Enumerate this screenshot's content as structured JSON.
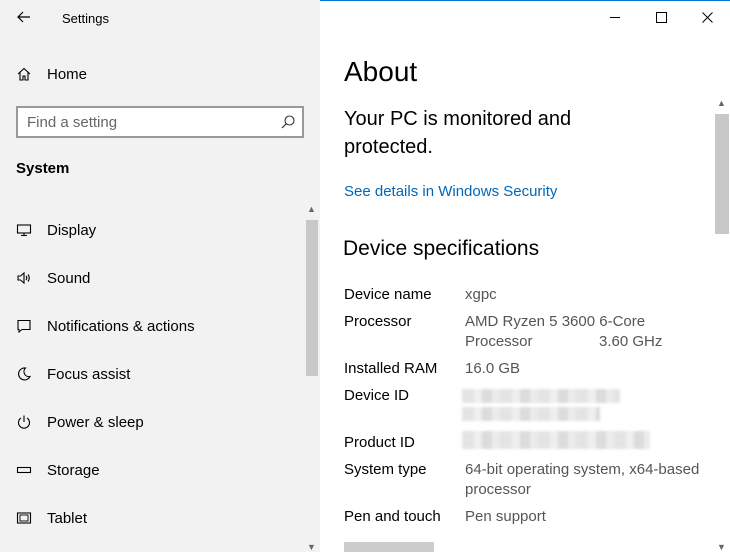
{
  "app": {
    "title": "Settings"
  },
  "sidebar": {
    "home_label": "Home",
    "search_placeholder": "Find a setting",
    "section_title": "System",
    "items": [
      {
        "label": "Display",
        "icon": "display-icon"
      },
      {
        "label": "Sound",
        "icon": "sound-icon"
      },
      {
        "label": "Notifications & actions",
        "icon": "notifications-icon"
      },
      {
        "label": "Focus assist",
        "icon": "moon-icon"
      },
      {
        "label": "Power & sleep",
        "icon": "power-icon"
      },
      {
        "label": "Storage",
        "icon": "storage-icon"
      },
      {
        "label": "Tablet",
        "icon": "tablet-icon"
      }
    ]
  },
  "main": {
    "title": "About",
    "security_status": "Your PC is monitored and protected.",
    "security_link": "See details in Windows Security",
    "specs_title": "Device specifications",
    "specs": {
      "device_name_label": "Device name",
      "device_name_value": "xgpc",
      "processor_label": "Processor",
      "processor_value_line1": "AMD Ryzen 5 3600 6-Core",
      "processor_value_line2": "Processor",
      "processor_speed": "3.60 GHz",
      "ram_label": "Installed RAM",
      "ram_value": "16.0 GB",
      "device_id_label": "Device ID",
      "product_id_label": "Product ID",
      "system_type_label": "System type",
      "system_type_value": "64-bit operating system, x64-based processor",
      "pen_label": "Pen and touch",
      "pen_value": "Pen support"
    }
  },
  "colors": {
    "accent": "#0078d7",
    "link": "#0067b8",
    "sidebar_bg": "#f2f2f2"
  }
}
